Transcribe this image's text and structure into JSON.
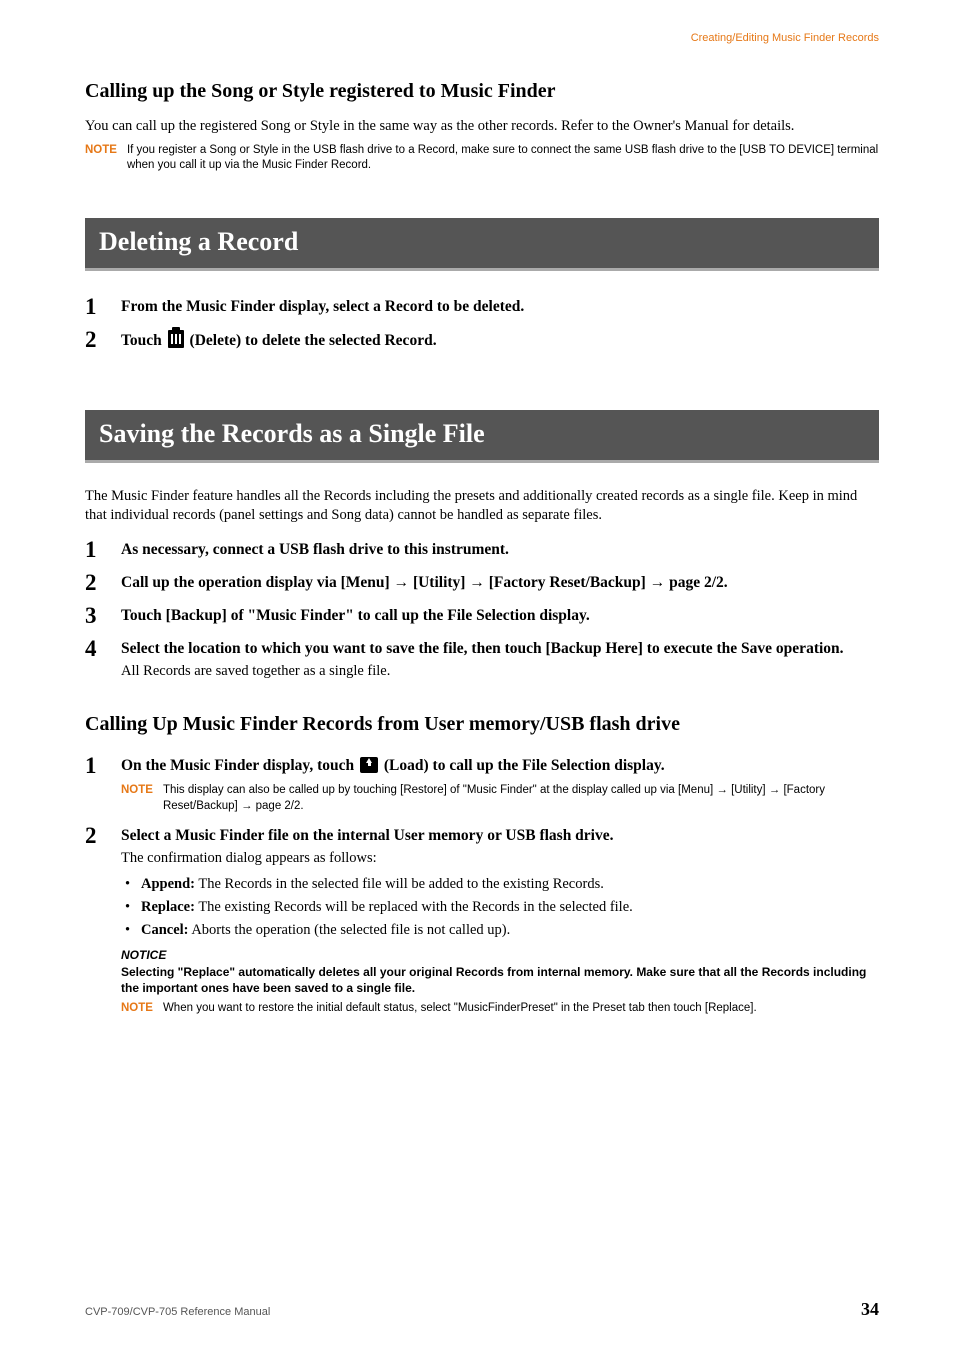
{
  "header": {
    "breadcrumb": "Creating/Editing Music Finder Records"
  },
  "sec1": {
    "title": "Calling up the Song or Style registered to Music Finder",
    "p1": "You can call up the registered Song or Style in the same way as the other records. Refer to the Owner's Manual for details.",
    "note_label": "NOTE",
    "note": "If you register a Song or Style in the USB flash drive to a Record, make sure to connect the same USB flash drive to the [USB TO DEVICE] terminal when you call it up via the Music Finder Record."
  },
  "sec2": {
    "title": "Deleting a Record",
    "step1": {
      "n": "1",
      "t": "From the Music Finder display, select a Record to be deleted."
    },
    "step2": {
      "n": "2",
      "t_a": "Touch ",
      "t_b": " (Delete) to delete the selected Record."
    }
  },
  "sec3": {
    "title": "Saving the Records as a Single File",
    "intro": "The Music Finder feature handles all the Records including the presets and additionally created records as a single file. Keep in mind that individual records (panel settings and Song data) cannot be handled as separate files.",
    "step1": {
      "n": "1",
      "t": "As necessary, connect a USB flash drive to this instrument."
    },
    "step2": {
      "n": "2",
      "t": "Call up the operation display via [Menu] → [Utility] → [Factory Reset/Backup] → page 2/2."
    },
    "step3": {
      "n": "3",
      "t": "Touch [Backup] of \"Music Finder\" to call up the File Selection display."
    },
    "step4": {
      "n": "4",
      "t": "Select the location to which you want to save the file, then touch [Backup Here] to execute the Save operation.",
      "sub": "All Records are saved together as a single file."
    }
  },
  "sec4": {
    "title": "Calling Up Music Finder Records from User memory/USB flash drive",
    "step1": {
      "n": "1",
      "t_a": "On the Music Finder display, touch ",
      "t_b": " (Load) to call up the File Selection display.",
      "note_label": "NOTE",
      "note": "This display can also be called up by touching [Restore] of \"Music Finder\" at the display called up via [Menu] → [Utility] → [Factory Reset/Backup] → page 2/2."
    },
    "step2": {
      "n": "2",
      "t": "Select a Music Finder file on the internal User memory or USB flash drive.",
      "sub": "The confirmation dialog appears as follows:",
      "opts": {
        "append_b": "Append:",
        "append_t": " The Records in the selected file will be added to the existing Records.",
        "replace_b": "Replace:",
        "replace_t": " The existing Records will be replaced with the Records in the selected file.",
        "cancel_b": "Cancel:",
        "cancel_t": " Aborts the operation (the selected file is not called up)."
      },
      "notice_label": "NOTICE",
      "notice": "Selecting \"Replace\" automatically deletes all your original Records from internal memory. Make sure that all the Records including the important ones have been saved to a single file.",
      "note_label": "NOTE",
      "note": "When you want to restore the initial default status, select \"MusicFinderPreset\" in the Preset tab then touch [Replace]."
    }
  },
  "footer": {
    "left": "CVP-709/CVP-705 Reference Manual",
    "right": "34"
  }
}
